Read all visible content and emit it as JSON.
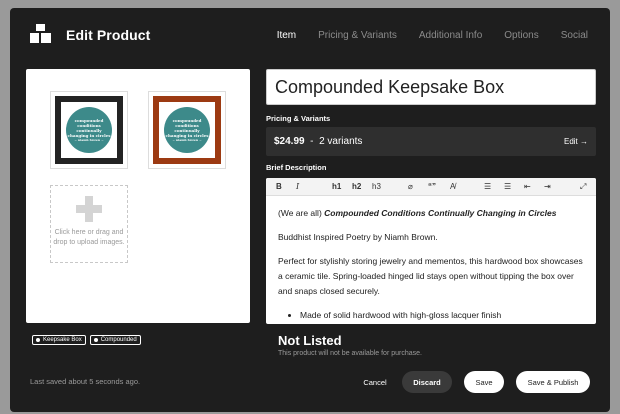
{
  "header": {
    "title": "Edit Product",
    "tabs": [
      "Item",
      "Pricing & Variants",
      "Additional Info",
      "Options",
      "Social"
    ],
    "active_tab": "Item"
  },
  "images": {
    "thumbnails": [
      {
        "caption": "compounded conditions continually changing in circles",
        "author": "~ niamh brown ~",
        "frame_color": "#232323"
      },
      {
        "caption": "compounded conditions continually changing in circles",
        "author": "~ niamh brown ~",
        "frame_color": "#9c3a12"
      }
    ],
    "upload_text": "Click here or drag and drop to upload images."
  },
  "tags": [
    "Keepsake Box",
    "Compounded"
  ],
  "product": {
    "name": "Compounded Keepsake Box"
  },
  "pricing": {
    "label": "Pricing & Variants",
    "price": "$24.99",
    "separator": "-",
    "variants": "2 variants",
    "edit_label": "Edit →"
  },
  "description": {
    "label": "Brief Description",
    "toolbar": [
      "B",
      "I",
      "h1",
      "h2",
      "h3",
      "⌀",
      "“”",
      "A̸",
      "☰",
      "☰",
      "⇤",
      "⇥",
      "⤢"
    ],
    "para1_prefix": "(We are all) ",
    "para1_italic": "Compounded Conditions Continually Changing in Circles",
    "para2": "Buddhist Inspired Poetry by Niamh Brown.",
    "para3": "Perfect for stylishly storing jewelry and mementos, this hardwood box showcases a ceramic tile. Spring-loaded hinged lid stays open without tipping the box over and snaps closed securely.",
    "bullet1": "Made of solid hardwood with high-gloss lacquer finish"
  },
  "status": {
    "title": "Not Listed",
    "subtitle": "This product will not be available for purchase."
  },
  "footer": {
    "saved_text": "Last saved about 5 seconds ago.",
    "cancel": "Cancel",
    "discard": "Discard",
    "save": "Save",
    "publish": "Save & Publish"
  }
}
